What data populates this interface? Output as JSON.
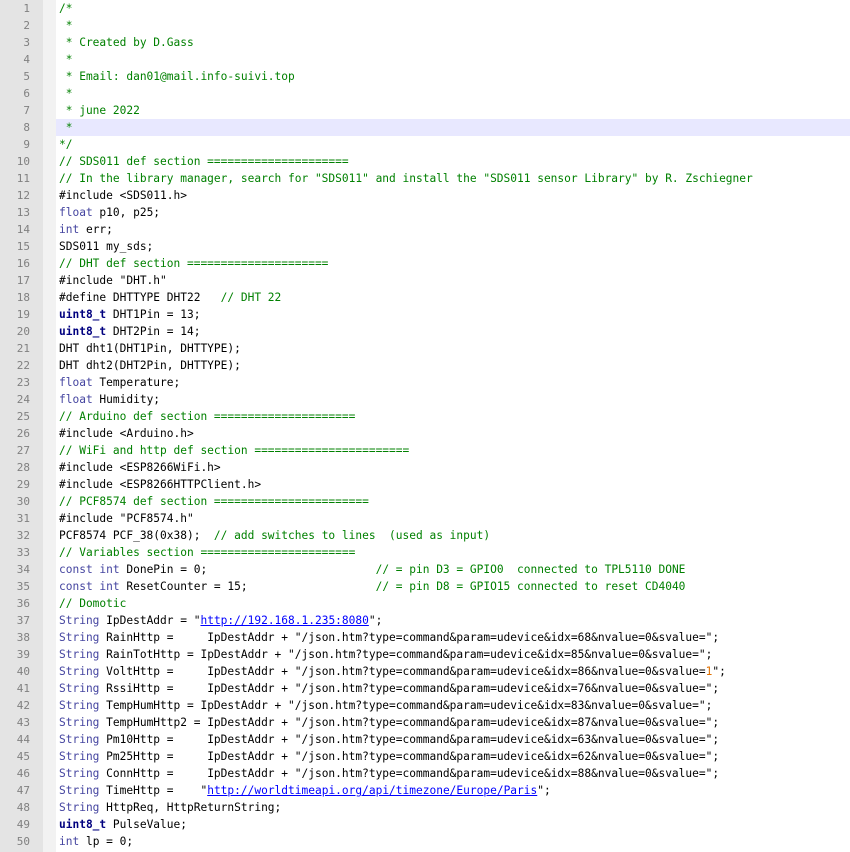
{
  "editor": {
    "colors": {
      "gutter": "#e4e4e4",
      "line_number": "#808080",
      "comment": "#008000",
      "keyword": "#00007f",
      "type": "#4545a0",
      "number": "#e07000",
      "url": "#0000ff",
      "current_line": "#e8e8ff"
    },
    "highlighted_line": 8,
    "lines": [
      [
        {
          "t": "/*",
          "c": "comment"
        }
      ],
      [
        {
          "t": " *",
          "c": "comment"
        }
      ],
      [
        {
          "t": " * Created by D.Gass",
          "c": "comment"
        }
      ],
      [
        {
          "t": " *",
          "c": "comment"
        }
      ],
      [
        {
          "t": " * Email: dan01@mail.info-suivi.top",
          "c": "comment"
        }
      ],
      [
        {
          "t": " *",
          "c": "comment"
        }
      ],
      [
        {
          "t": " * june 2022",
          "c": "comment"
        }
      ],
      [
        {
          "t": " *",
          "c": "comment"
        }
      ],
      [
        {
          "t": "*/",
          "c": "comment"
        }
      ],
      [
        {
          "t": "// SDS011 def section =====================",
          "c": "comment"
        }
      ],
      [
        {
          "t": "// In the library manager, search for \"SDS011\" and install the \"SDS011 sensor Library\" by R. Zschiegner",
          "c": "comment"
        }
      ],
      [
        {
          "t": "#include <SDS011.h>",
          "c": ""
        }
      ],
      [
        {
          "t": "float",
          "c": "type"
        },
        {
          "t": " p10, p25;",
          "c": ""
        }
      ],
      [
        {
          "t": "int",
          "c": "type"
        },
        {
          "t": " err;",
          "c": ""
        }
      ],
      [
        {
          "t": "SDS011 my_sds;",
          "c": ""
        }
      ],
      [
        {
          "t": "// DHT def section =====================",
          "c": "comment"
        }
      ],
      [
        {
          "t": "#include \"DHT.h\"",
          "c": ""
        }
      ],
      [
        {
          "t": "#define DHTTYPE DHT22   ",
          "c": ""
        },
        {
          "t": "// DHT 22",
          "c": "comment"
        }
      ],
      [
        {
          "t": "uint8_t",
          "c": "kw"
        },
        {
          "t": " DHT1Pin = 13;",
          "c": ""
        }
      ],
      [
        {
          "t": "uint8_t",
          "c": "kw"
        },
        {
          "t": " DHT2Pin = 14;",
          "c": ""
        }
      ],
      [
        {
          "t": "DHT dht1(DHT1Pin, DHTTYPE);",
          "c": ""
        }
      ],
      [
        {
          "t": "DHT dht2(DHT2Pin, DHTTYPE);",
          "c": ""
        }
      ],
      [
        {
          "t": "float",
          "c": "type"
        },
        {
          "t": " Temperature;",
          "c": ""
        }
      ],
      [
        {
          "t": "float",
          "c": "type"
        },
        {
          "t": " Humidity;",
          "c": ""
        }
      ],
      [
        {
          "t": "// Arduino def section =====================",
          "c": "comment"
        }
      ],
      [
        {
          "t": "#include <Arduino.h>",
          "c": ""
        }
      ],
      [
        {
          "t": "// WiFi and http def section =======================",
          "c": "comment"
        }
      ],
      [
        {
          "t": "#include <ESP8266WiFi.h>",
          "c": ""
        }
      ],
      [
        {
          "t": "#include <ESP8266HTTPClient.h>",
          "c": ""
        }
      ],
      [
        {
          "t": "// PCF8574 def section =======================",
          "c": "comment"
        }
      ],
      [
        {
          "t": "#include \"PCF8574.h\"",
          "c": ""
        }
      ],
      [
        {
          "t": "PCF8574 PCF_38(0x38);  ",
          "c": ""
        },
        {
          "t": "// add switches to lines  (used as input)",
          "c": "comment"
        }
      ],
      [
        {
          "t": "// Variables section =======================",
          "c": "comment"
        }
      ],
      [
        {
          "t": "const int",
          "c": "type"
        },
        {
          "t": " DonePin = 0;                         ",
          "c": ""
        },
        {
          "t": "// = pin D3 = GPIO0  connected to TPL5110 DONE",
          "c": "comment"
        }
      ],
      [
        {
          "t": "const int",
          "c": "type"
        },
        {
          "t": " ResetCounter = 15;                   ",
          "c": ""
        },
        {
          "t": "// = pin D8 = GPIO15 connected to reset CD4040",
          "c": "comment"
        }
      ],
      [
        {
          "t": "// Domotic",
          "c": "comment"
        }
      ],
      [
        {
          "t": "String",
          "c": "type"
        },
        {
          "t": " IpDestAddr = \"",
          "c": ""
        },
        {
          "t": "http://192.168.1.235:8080",
          "c": "url"
        },
        {
          "t": "\";",
          "c": ""
        }
      ],
      [
        {
          "t": "String",
          "c": "type"
        },
        {
          "t": " RainHttp =     IpDestAddr + \"/json.htm?type=command&param=udevice&idx=68&nvalue=0&svalue=\";",
          "c": ""
        }
      ],
      [
        {
          "t": "String",
          "c": "type"
        },
        {
          "t": " RainTotHttp = IpDestAddr + \"/json.htm?type=command&param=udevice&idx=85&nvalue=0&svalue=\";",
          "c": ""
        }
      ],
      [
        {
          "t": "String",
          "c": "type"
        },
        {
          "t": " VoltHttp =     IpDestAddr + \"/json.htm?type=command&param=udevice&idx=86&nvalue=0&svalue=",
          "c": ""
        },
        {
          "t": "1",
          "c": "num"
        },
        {
          "t": "\";",
          "c": ""
        }
      ],
      [
        {
          "t": "String",
          "c": "type"
        },
        {
          "t": " RssiHttp =     IpDestAddr + \"/json.htm?type=command&param=udevice&idx=76&nvalue=0&svalue=\";",
          "c": ""
        }
      ],
      [
        {
          "t": "String",
          "c": "type"
        },
        {
          "t": " TempHumHttp = IpDestAddr + \"/json.htm?type=command&param=udevice&idx=83&nvalue=0&svalue=\";",
          "c": ""
        }
      ],
      [
        {
          "t": "String",
          "c": "type"
        },
        {
          "t": " TempHumHttp2 = IpDestAddr + \"/json.htm?type=command&param=udevice&idx=87&nvalue=0&svalue=\";",
          "c": ""
        }
      ],
      [
        {
          "t": "String",
          "c": "type"
        },
        {
          "t": " Pm10Http =     IpDestAddr + \"/json.htm?type=command&param=udevice&idx=63&nvalue=0&svalue=\";",
          "c": ""
        }
      ],
      [
        {
          "t": "String",
          "c": "type"
        },
        {
          "t": " Pm25Http =     IpDestAddr + \"/json.htm?type=command&param=udevice&idx=62&nvalue=0&svalue=\";",
          "c": ""
        }
      ],
      [
        {
          "t": "String",
          "c": "type"
        },
        {
          "t": " ConnHttp =     IpDestAddr + \"/json.htm?type=command&param=udevice&idx=88&nvalue=0&svalue=\";",
          "c": ""
        }
      ],
      [
        {
          "t": "String",
          "c": "type"
        },
        {
          "t": " TimeHttp =    \"",
          "c": ""
        },
        {
          "t": "http://worldtimeapi.org/api/timezone/Europe/Paris",
          "c": "url"
        },
        {
          "t": "\";",
          "c": ""
        }
      ],
      [
        {
          "t": "String",
          "c": "type"
        },
        {
          "t": " HttpReq, HttpReturnString;",
          "c": ""
        }
      ],
      [
        {
          "t": "uint8_t",
          "c": "kw"
        },
        {
          "t": " PulseValue;",
          "c": ""
        }
      ],
      [
        {
          "t": "int",
          "c": "type"
        },
        {
          "t": " lp = 0;",
          "c": ""
        }
      ]
    ]
  }
}
